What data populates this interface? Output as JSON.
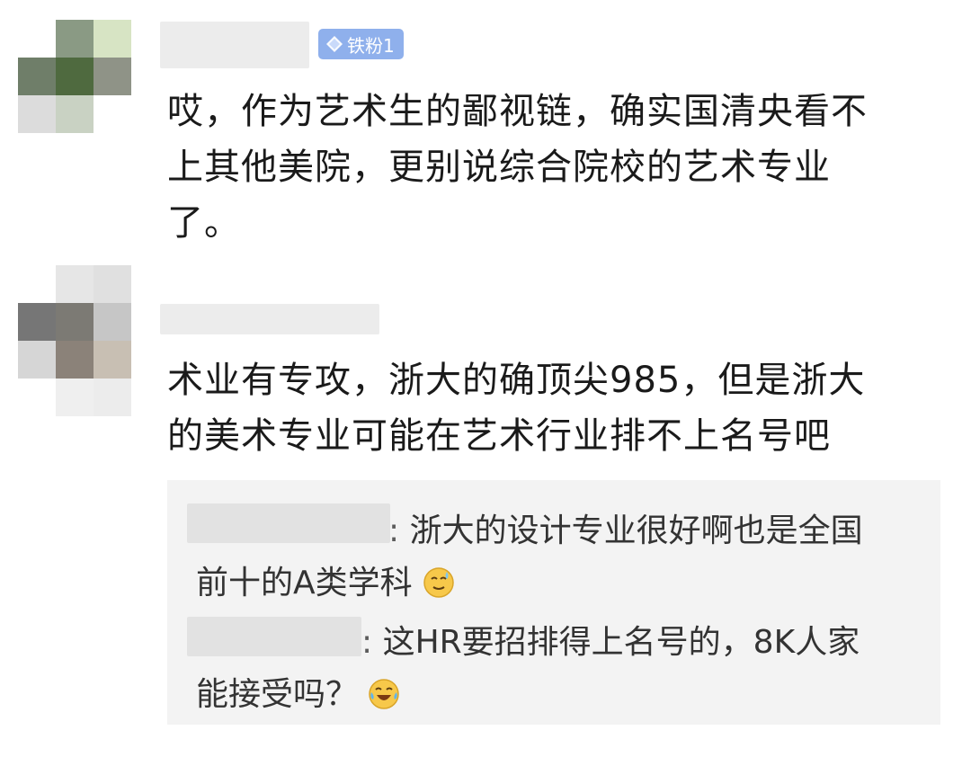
{
  "comments": [
    {
      "badge": "铁粉1",
      "text_lines": [
        "哎，作为艺术生的鄙视链，确实国清央看不",
        "上其他美院，更别说综合院校的艺术专业",
        "了。"
      ]
    },
    {
      "text_lines": [
        "术业有专攻，浙大的确顶尖985，但是浙大",
        "的美术专业可能在艺术行业排不上名号吧"
      ]
    }
  ],
  "replies": [
    {
      "sep": ":",
      "line1": "浙大的设计专业很好啊也是全国",
      "line2": "前十的A类学科",
      "emoji": "sweat-smile-emoji"
    },
    {
      "sep": ":",
      "line1": "这HR要招排得上名号的，8K人家",
      "line2": "能接受吗？",
      "emoji": "laugh-cry-emoji"
    }
  ],
  "colors": {
    "badge_bg": "#8fb0ec",
    "reply_bg": "#f3f3f3"
  }
}
